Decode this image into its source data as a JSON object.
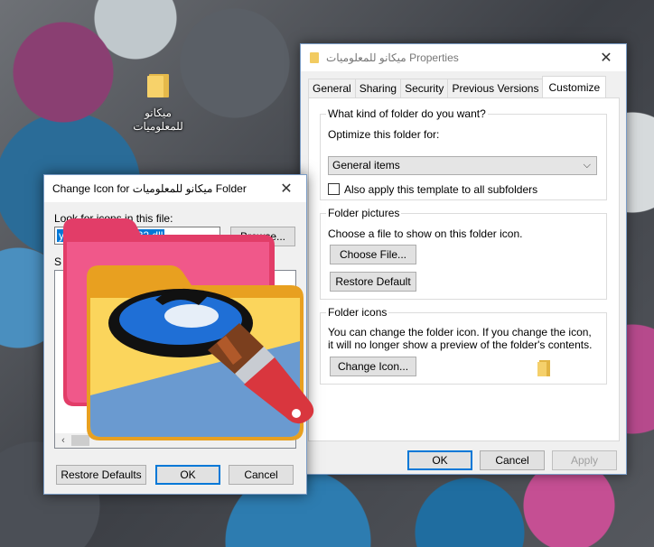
{
  "desktop": {
    "icon_label": "ميكانو للمعلوميات"
  },
  "properties": {
    "title": "ميكانو للمعلوميات Properties",
    "tabs": [
      "General",
      "Sharing",
      "Security",
      "Previous Versions",
      "Customize"
    ],
    "active_tab": "Customize",
    "folder_type": {
      "title": "What kind of folder do you want?",
      "optimize_label": "Optimize this folder for:",
      "selected": "General items",
      "apply_all_label": "Also apply this template to all subfolders",
      "apply_all_checked": false
    },
    "pictures": {
      "title": "Folder pictures",
      "description": "Choose a file to show on this folder icon.",
      "choose_file": "Choose File...",
      "restore_default": "Restore Default"
    },
    "icons": {
      "title": "Folder icons",
      "description": "You can change the folder icon. If you change the icon, it will no longer show a preview of the folder's contents.",
      "change_icon": "Change Icon..."
    },
    "buttons": {
      "ok": "OK",
      "cancel": "Cancel",
      "apply": "Apply"
    }
  },
  "change_icon": {
    "title": "Change Icon for ميكانو للمعلوميات Folder",
    "look_for_label": "Look for icons in this file:",
    "path_value": "ystem32\\SHELL32.dll",
    "browse": "Browse...",
    "select_label": "S",
    "buttons": {
      "restore_defaults": "Restore Defaults",
      "ok": "OK",
      "cancel": "Cancel"
    }
  },
  "colors": {
    "accent": "#0078d7",
    "folder_yellow": "#f7d26a",
    "folder_pink": "#e8426a",
    "brush_red": "#d9363e"
  },
  "icons": [
    "folder-icon",
    "close-icon",
    "chevron-down-icon",
    "paint-brush-icon"
  ]
}
